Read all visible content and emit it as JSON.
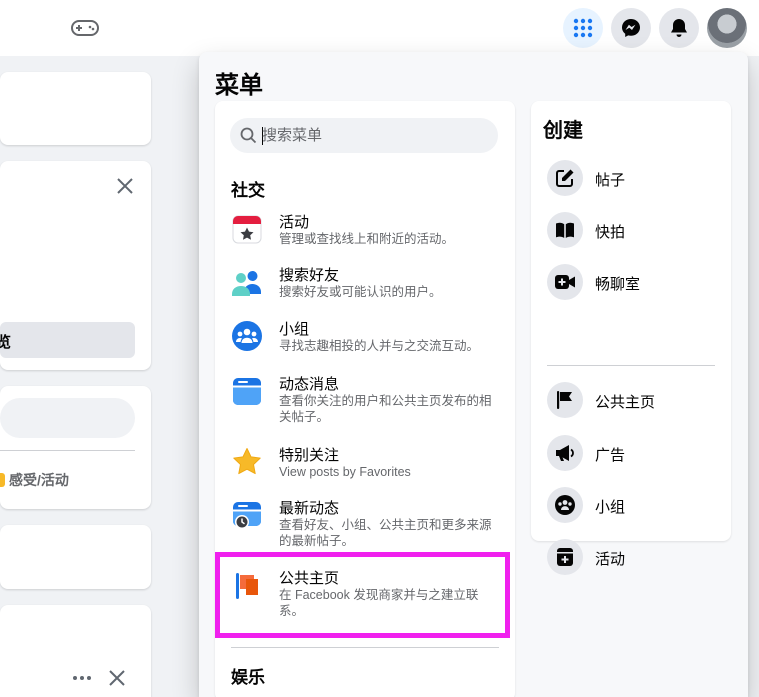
{
  "background": {
    "feeling_activity": "感受/活动",
    "button_partial": "览"
  },
  "menu": {
    "title": "菜单",
    "search": {
      "placeholder": "搜索菜单"
    },
    "social": {
      "title": "社交",
      "items": [
        {
          "label": "活动",
          "desc": "管理或查找线上和附近的活动。",
          "icon": "calendar-star-icon"
        },
        {
          "label": "搜索好友",
          "desc": "搜索好友或可能认识的用户。",
          "icon": "friends-icon"
        },
        {
          "label": "小组",
          "desc": "寻找志趣相投的人并与之交流互动。",
          "icon": "groups-icon"
        },
        {
          "label": "动态消息",
          "desc": "查看你关注的用户和公共主页发布的相关帖子。",
          "icon": "feed-icon"
        },
        {
          "label": "特别关注",
          "desc": "View posts by Favorites",
          "icon": "star-icon"
        },
        {
          "label": "最新动态",
          "desc": "查看好友、小组、公共主页和更多来源的最新帖子。",
          "icon": "recent-feed-icon"
        },
        {
          "label": "公共主页",
          "desc": "在 Facebook 发现商家并与之建立联系。",
          "icon": "pages-flag-icon"
        }
      ]
    },
    "entertainment": {
      "title": "娱乐"
    },
    "create": {
      "title": "创建",
      "items": [
        {
          "label": "帖子",
          "icon": "edit-post-icon"
        },
        {
          "label": "快拍",
          "icon": "story-book-icon"
        },
        {
          "label": "畅聊室",
          "icon": "video-room-icon"
        },
        {
          "label": "公共主页",
          "icon": "flag-icon"
        },
        {
          "label": "广告",
          "icon": "megaphone-icon"
        },
        {
          "label": "小组",
          "icon": "group-icon"
        },
        {
          "label": "活动",
          "icon": "event-icon"
        }
      ]
    }
  },
  "colors": {
    "accent": "#1877f2",
    "highlight": "#f020ee",
    "text_primary": "#050505",
    "text_secondary": "#65676b"
  }
}
